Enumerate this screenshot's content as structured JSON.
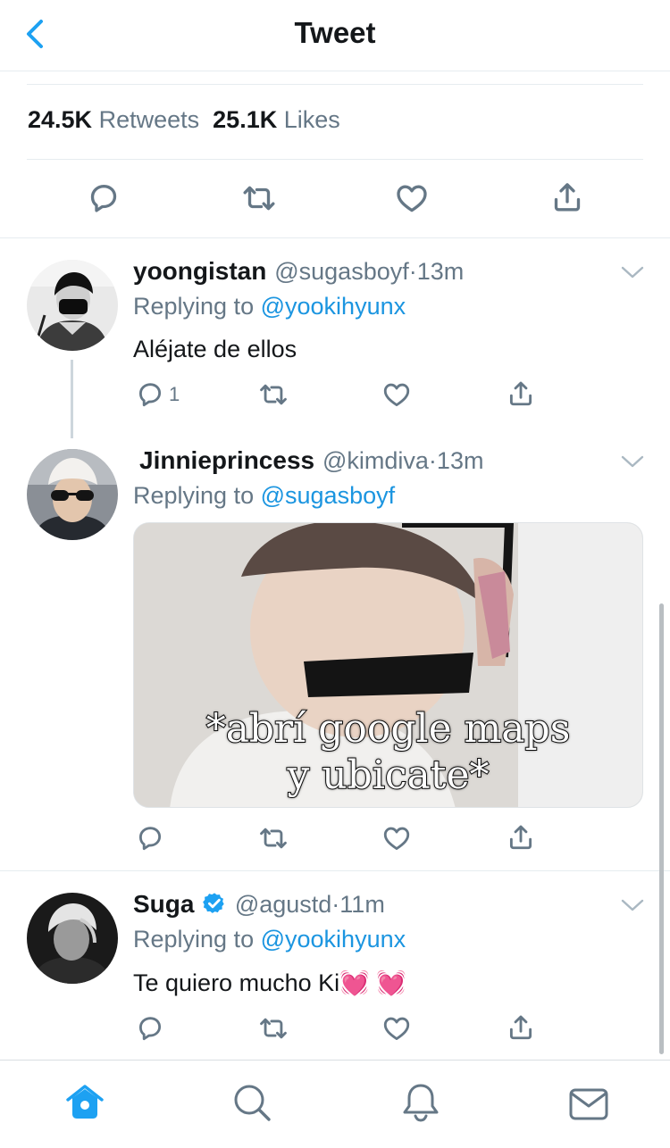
{
  "header": {
    "title": "Tweet"
  },
  "stats": {
    "retweets_count": "24.5K",
    "retweets_label": "Retweets",
    "likes_count": "25.1K",
    "likes_label": "Likes"
  },
  "replies": [
    {
      "name": "yoongistan",
      "handle": "@sugasboyf",
      "time": "13m",
      "replying_label": "Replying to",
      "replying_to": "@yookihyunx",
      "text": "Aléjate de ellos",
      "reply_count": "1"
    },
    {
      "name": "Jinnieprincess",
      "handle": "@kimdiva",
      "time": "13m",
      "replying_label": "Replying to",
      "replying_to": "@sugasboyf",
      "media_caption_line1": "*abrí google maps",
      "media_caption_line2": "y ubicate*"
    },
    {
      "name": "Suga",
      "handle": "@agustd",
      "time": "11m",
      "verified": true,
      "replying_label": "Replying to",
      "replying_to": "@yookihyunx",
      "text": "Te quiero mucho Ki💓 💓"
    }
  ],
  "dot_separator": "·",
  "colors": {
    "accent": "#1da1f2",
    "link": "#1b95e0",
    "muted": "#657786",
    "divider": "#e6ecf0",
    "text": "#14171a"
  },
  "icons": {
    "back": "chevron-left-icon",
    "reply": "speech-bubble-icon",
    "retweet": "retweet-icon",
    "like": "heart-icon",
    "share": "share-icon",
    "more": "chevron-down-icon",
    "verified": "verified-badge-icon",
    "tab_home": "home-icon",
    "tab_search": "search-icon",
    "tab_notifications": "bell-icon",
    "tab_messages": "mail-icon"
  }
}
